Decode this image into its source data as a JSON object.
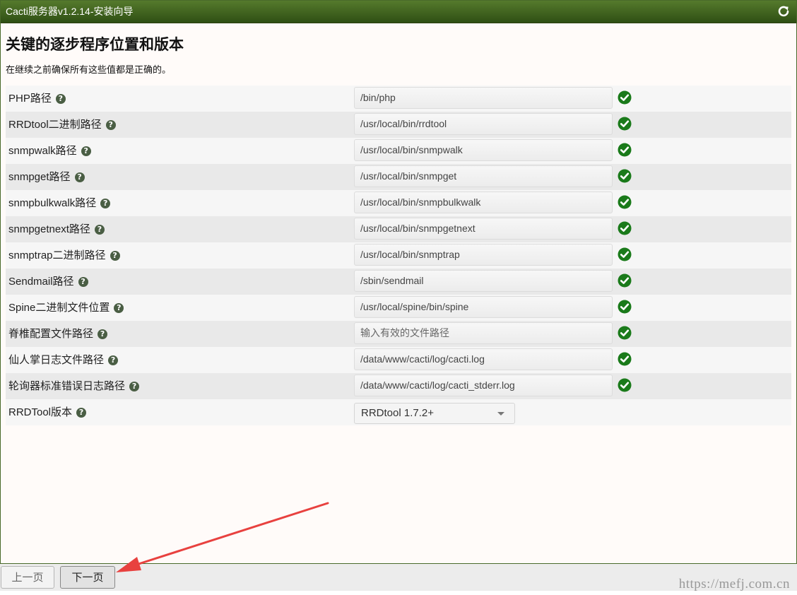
{
  "window": {
    "title": "Cacti服务器v1.2.14-安装向导",
    "heading": "关键的逐步程序位置和版本",
    "subtext": "在继续之前确保所有这些值都是正确的。"
  },
  "help_glyph": "?",
  "paths": [
    {
      "label": "PHP路径",
      "value": "/bin/php",
      "placeholder": ""
    },
    {
      "label": "RRDtool二进制路径",
      "value": "/usr/local/bin/rrdtool",
      "placeholder": ""
    },
    {
      "label": "snmpwalk路径",
      "value": "/usr/local/bin/snmpwalk",
      "placeholder": ""
    },
    {
      "label": "snmpget路径",
      "value": "/usr/local/bin/snmpget",
      "placeholder": ""
    },
    {
      "label": "snmpbulkwalk路径",
      "value": "/usr/local/bin/snmpbulkwalk",
      "placeholder": ""
    },
    {
      "label": "snmpgetnext路径",
      "value": "/usr/local/bin/snmpgetnext",
      "placeholder": ""
    },
    {
      "label": "snmptrap二进制路径",
      "value": "/usr/local/bin/snmptrap",
      "placeholder": ""
    },
    {
      "label": "Sendmail路径",
      "value": "/sbin/sendmail",
      "placeholder": ""
    },
    {
      "label": "Spine二进制文件位置",
      "value": "/usr/local/spine/bin/spine",
      "placeholder": ""
    },
    {
      "label": "脊椎配置文件路径",
      "value": "",
      "placeholder": "输入有效的文件路径"
    },
    {
      "label": "仙人掌日志文件路径",
      "value": "/data/www/cacti/log/cacti.log",
      "placeholder": ""
    },
    {
      "label": "轮询器标准错误日志路径",
      "value": "/data/www/cacti/log/cacti_stderr.log",
      "placeholder": ""
    }
  ],
  "rrdtool_version": {
    "label": "RRDTool版本",
    "selected": "RRDtool 1.7.2+"
  },
  "buttons": {
    "prev": "上一页",
    "next": "下一页"
  },
  "watermark": "https://mefj.com.cn",
  "colors": {
    "titlebar": "#3f6420",
    "check": "#1a7a1a",
    "arrow": "#e8413f"
  },
  "icons": {
    "refresh": "refresh-icon",
    "status": "check-circle-icon",
    "help": "question-circle-icon"
  }
}
